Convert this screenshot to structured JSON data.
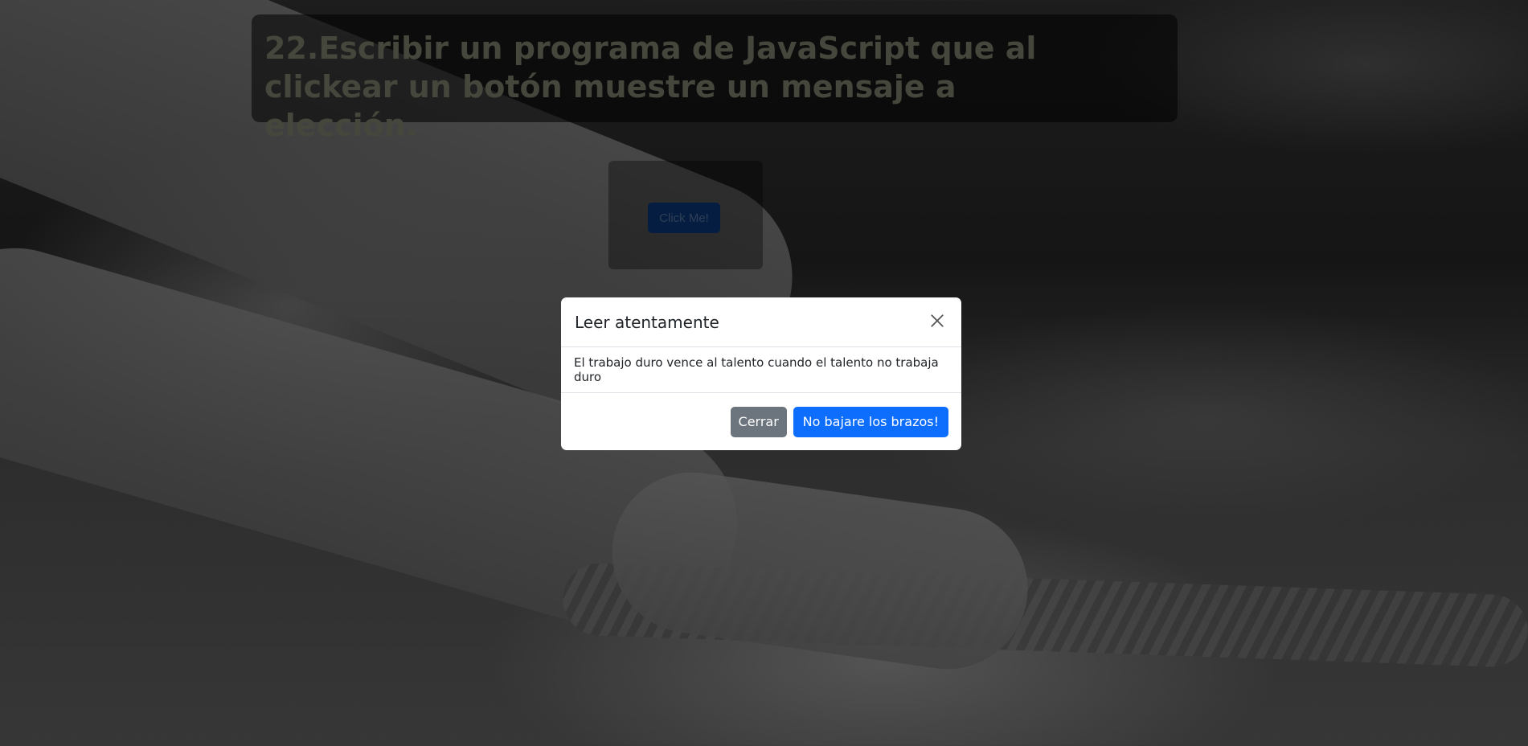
{
  "page": {
    "heading": "22.Escribir un programa de JavaScript que al clickear un botón muestre un mensaje a elección.",
    "click_button_label": "Click Me!"
  },
  "modal": {
    "title": "Leer atentamente",
    "body": "El trabajo duro vence al talento cuando el talento no trabaja duro",
    "close_icon": "close-icon",
    "buttons": {
      "secondary_label": "Cerrar",
      "primary_label": "No bajare los brazos!"
    }
  },
  "colors": {
    "primary": "#0d6efd",
    "secondary": "#6c757d",
    "backdrop": "rgba(0,0,0,0.5)"
  }
}
